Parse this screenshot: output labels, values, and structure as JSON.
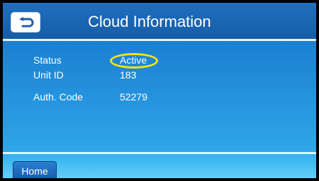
{
  "header": {
    "title": "Cloud Information",
    "back_icon": "back-arrow-icon"
  },
  "info": [
    {
      "label": "Status",
      "value": "Active"
    },
    {
      "label": "Unit ID",
      "value": "183"
    },
    {
      "label": "Auth. Code",
      "value": "52279"
    }
  ],
  "footer": {
    "home_label": "Home"
  },
  "colors": {
    "header": "#165da7",
    "content": "#1d88d4",
    "footer": "#2eb1ef",
    "highlight": "#f5e600",
    "text": "#ffffff"
  }
}
